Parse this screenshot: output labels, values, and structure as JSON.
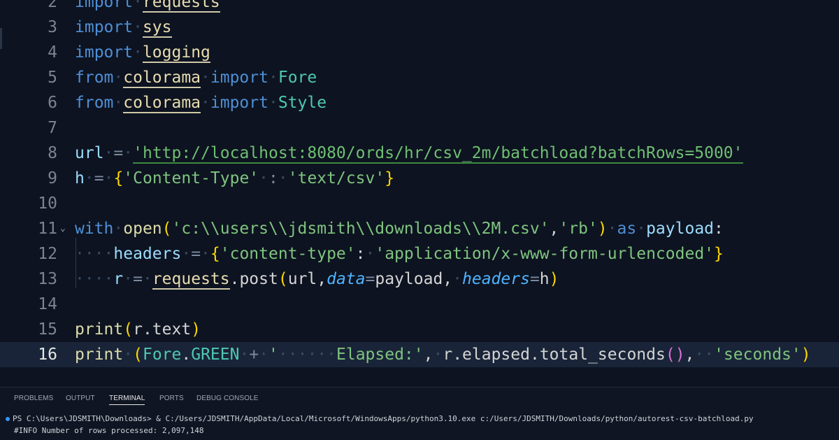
{
  "editor": {
    "lines": [
      {
        "n": "2",
        "tokens": [
          [
            "kw",
            "import"
          ],
          [
            "dot",
            "·"
          ],
          [
            "mod",
            "requests"
          ]
        ]
      },
      {
        "n": "3",
        "tokens": [
          [
            "kw",
            "import"
          ],
          [
            "dot",
            "·"
          ],
          [
            "mod",
            "sys"
          ]
        ]
      },
      {
        "n": "4",
        "tokens": [
          [
            "kw",
            "import"
          ],
          [
            "dot",
            "·"
          ],
          [
            "mod",
            "logging"
          ]
        ]
      },
      {
        "n": "5",
        "tokens": [
          [
            "kw",
            "from"
          ],
          [
            "dot",
            "·"
          ],
          [
            "mod",
            "colorama"
          ],
          [
            "dot",
            "·"
          ],
          [
            "kw",
            "import"
          ],
          [
            "dot",
            "·"
          ],
          [
            "cls",
            "Fore"
          ]
        ]
      },
      {
        "n": "6",
        "tokens": [
          [
            "kw",
            "from"
          ],
          [
            "dot",
            "·"
          ],
          [
            "mod",
            "colorama"
          ],
          [
            "dot",
            "·"
          ],
          [
            "kw",
            "import"
          ],
          [
            "dot",
            "·"
          ],
          [
            "cls",
            "Style"
          ]
        ]
      },
      {
        "n": "7",
        "tokens": []
      },
      {
        "n": "8",
        "tokens": [
          [
            "var",
            "url"
          ],
          [
            "dot",
            "·"
          ],
          [
            "op",
            "="
          ],
          [
            "dot",
            "·"
          ],
          [
            "url",
            "'http://localhost:8080/ords/hr/csv_2m/batchload?batchRows=5000'"
          ]
        ]
      },
      {
        "n": "9",
        "tokens": [
          [
            "var",
            "h"
          ],
          [
            "dot",
            "·"
          ],
          [
            "op",
            "="
          ],
          [
            "dot",
            "·"
          ],
          [
            "brk",
            "{"
          ],
          [
            "str2",
            "'Content-Type'"
          ],
          [
            "dot",
            "·"
          ],
          [
            "op",
            ":"
          ],
          [
            "dot",
            "·"
          ],
          [
            "str2",
            "'text/csv'"
          ],
          [
            "brk",
            "}"
          ]
        ]
      },
      {
        "n": "10",
        "tokens": []
      },
      {
        "n": "11",
        "fold": true,
        "tokens": [
          [
            "kw",
            "with"
          ],
          [
            "dot",
            "·"
          ],
          [
            "fn",
            "open"
          ],
          [
            "brk",
            "("
          ],
          [
            "str2",
            "'c:\\\\users\\\\jdsmith\\\\downloads\\\\2M.csv'"
          ],
          [
            "plain",
            ","
          ],
          [
            "str2",
            "'rb'"
          ],
          [
            "brk",
            ")"
          ],
          [
            "dot",
            "·"
          ],
          [
            "kw",
            "as"
          ],
          [
            "dot",
            "·"
          ],
          [
            "var",
            "payload"
          ],
          [
            "plain",
            ":"
          ]
        ]
      },
      {
        "n": "12",
        "tokens": [
          [
            "dot",
            "····"
          ],
          [
            "var",
            "headers"
          ],
          [
            "dot",
            "·"
          ],
          [
            "op",
            "="
          ],
          [
            "dot",
            "·"
          ],
          [
            "brk",
            "{"
          ],
          [
            "str2",
            "'content-type'"
          ],
          [
            "plain",
            ":"
          ],
          [
            "dot",
            "·"
          ],
          [
            "str2",
            "'application/x-www-form-urlencoded'"
          ],
          [
            "brk",
            "}"
          ]
        ]
      },
      {
        "n": "13",
        "tokens": [
          [
            "dot",
            "····"
          ],
          [
            "var",
            "r"
          ],
          [
            "dot",
            "·"
          ],
          [
            "op",
            "="
          ],
          [
            "dot",
            "·"
          ],
          [
            "mod",
            "requests"
          ],
          [
            "plain",
            ".post"
          ],
          [
            "brk",
            "("
          ],
          [
            "plain",
            "url,"
          ],
          [
            "param",
            "data"
          ],
          [
            "op",
            "="
          ],
          [
            "plain",
            "payload,"
          ],
          [
            "dot",
            "·"
          ],
          [
            "param",
            "headers"
          ],
          [
            "op",
            "="
          ],
          [
            "plain",
            "h"
          ],
          [
            "brk",
            ")"
          ]
        ]
      },
      {
        "n": "14",
        "tokens": []
      },
      {
        "n": "15",
        "tokens": [
          [
            "fn",
            "print"
          ],
          [
            "brk",
            "("
          ],
          [
            "plain",
            "r.text"
          ],
          [
            "brk",
            ")"
          ]
        ]
      },
      {
        "n": "16",
        "current": true,
        "tokens": [
          [
            "fn",
            "print"
          ],
          [
            "dot",
            "·"
          ],
          [
            "brk",
            "("
          ],
          [
            "cls",
            "Fore"
          ],
          [
            "plain",
            "."
          ],
          [
            "cls",
            "GREEN"
          ],
          [
            "dot",
            "·"
          ],
          [
            "op",
            "+"
          ],
          [
            "dot",
            "·"
          ],
          [
            "str2",
            "'"
          ],
          [
            "dot",
            "······"
          ],
          [
            "str2",
            "Elapsed:'"
          ],
          [
            "plain",
            ","
          ],
          [
            "dot",
            "·"
          ],
          [
            "plain",
            "r.elapsed.total_seconds"
          ],
          [
            "brk2",
            "()"
          ],
          [
            "plain",
            ","
          ],
          [
            "dot",
            "··"
          ],
          [
            "str2",
            "'seconds'"
          ],
          [
            "brk",
            ")"
          ]
        ]
      }
    ]
  },
  "panel": {
    "tabs": [
      {
        "label": "PROBLEMS",
        "active": false
      },
      {
        "label": "OUTPUT",
        "active": false
      },
      {
        "label": "TERMINAL",
        "active": true
      },
      {
        "label": "PORTS",
        "active": false
      },
      {
        "label": "DEBUG CONSOLE",
        "active": false
      }
    ],
    "terminal": {
      "line1": "PS C:\\Users\\JDSMITH\\Downloads> & C:/Users/JDSMITH/AppData/Local/Microsoft/WindowsApps/python3.10.exe c:/Users/JDSMITH/Downloads/python/autorest-csv-batchload.py",
      "line2": "#INFO Number of rows processed: 2,097,148"
    }
  },
  "colors": {
    "background": "#0d1320",
    "current_line": "#192438",
    "accent": "#3794ff"
  }
}
